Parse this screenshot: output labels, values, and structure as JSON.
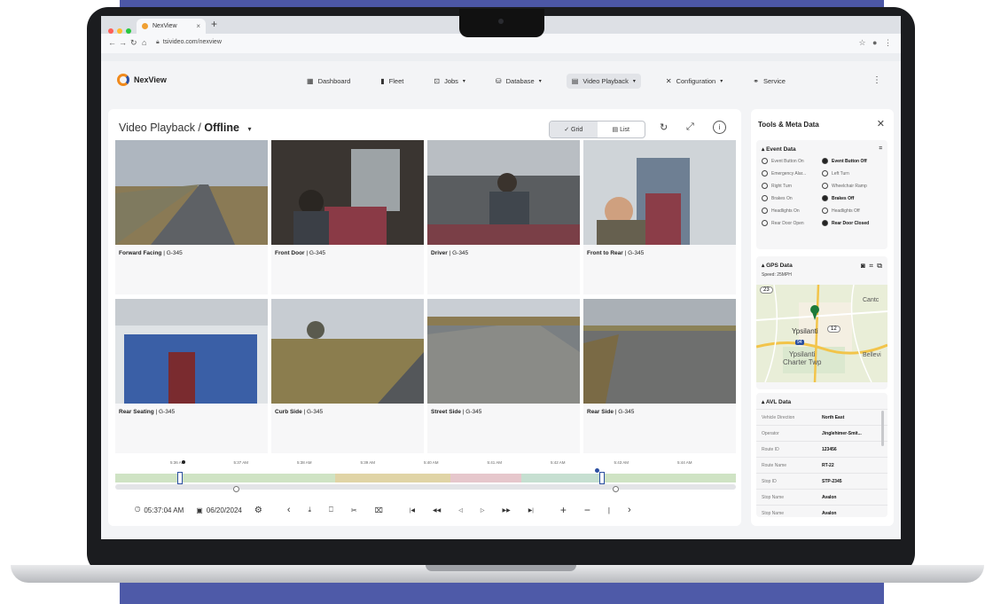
{
  "browser": {
    "tab_title": "NexView",
    "tab_close": "×",
    "new_tab": "+",
    "url": "tsivideo.com/nexview"
  },
  "app": {
    "brand": "NexView",
    "nav": [
      {
        "label": "Dashboard",
        "icon": "dashboard-icon",
        "dropdown": false,
        "active": false
      },
      {
        "label": "Fleet",
        "icon": "fleet-icon",
        "dropdown": false,
        "active": false
      },
      {
        "label": "Jobs",
        "icon": "jobs-icon",
        "dropdown": true,
        "active": false
      },
      {
        "label": "Database",
        "icon": "database-icon",
        "dropdown": true,
        "active": false
      },
      {
        "label": "Video Playback",
        "icon": "video-icon",
        "dropdown": true,
        "active": true
      },
      {
        "label": "Configuration",
        "icon": "tools-icon",
        "dropdown": true,
        "active": false
      },
      {
        "label": "Service",
        "icon": "service-icon",
        "dropdown": false,
        "active": false
      }
    ]
  },
  "main": {
    "title_prefix": "Video Playback / ",
    "title_mode": "Offline",
    "view_grid": "✓  Grid",
    "view_list": "▤  List",
    "cameras": [
      {
        "name": "Forward Facing",
        "id": " | G-345"
      },
      {
        "name": "Front Door",
        "id": " | G-345"
      },
      {
        "name": "Driver",
        "id": " | G-345"
      },
      {
        "name": "Front to Rear",
        "id": " | G-345"
      },
      {
        "name": "Rear Seating",
        "id": " | G-345"
      },
      {
        "name": "Curb Side",
        "id": " | G-345"
      },
      {
        "name": "Street Side",
        "id": " | G-345"
      },
      {
        "name": "Rear Side",
        "id": " | G-345"
      }
    ]
  },
  "timeline": {
    "ticks": [
      "5:36 AM",
      "5:37 AM",
      "5:38 AM",
      "5:39 AM",
      "5:40 AM",
      "5:41 AM",
      "5:42 AM",
      "5:43 AM",
      "5:44 AM"
    ],
    "segment_colors": [
      "#cfe3c4",
      "#e0d4a6",
      "#e6c7cc",
      "#c6dfd1",
      "#cfe3c4"
    ],
    "time": "05:37:04 AM",
    "date": "06/20/2024"
  },
  "side": {
    "title": "Tools & Meta Data",
    "event_section": "Event Data",
    "events": [
      {
        "label": "Event Button On",
        "selected": false
      },
      {
        "label": "Event Button Off",
        "selected": true
      },
      {
        "label": "Emergency Alar...",
        "selected": false
      },
      {
        "label": "Left Turn",
        "selected": false
      },
      {
        "label": "Right Turn",
        "selected": false
      },
      {
        "label": "Wheelchair Ramp",
        "selected": false
      },
      {
        "label": "Brakes On",
        "selected": false
      },
      {
        "label": "Brakes Off",
        "selected": true
      },
      {
        "label": "Headlights On",
        "selected": false
      },
      {
        "label": "Headlights Off",
        "selected": false
      },
      {
        "label": "Rear Door Open",
        "selected": false
      },
      {
        "label": "Rear Door Closed",
        "selected": true
      }
    ],
    "gps_section": "GPS Data",
    "speed": "Speed: 25MPH",
    "map_labels": {
      "ypsilanti": "Ypsilanti",
      "charter": "Ypsilanti\nCharter Twp",
      "canton": "Cantc",
      "belleville": "Bellevi",
      "route12": "12",
      "route23": "23",
      "route94": "94"
    },
    "avl_section": "AVL Data",
    "avl": [
      {
        "k": "Vehicle Direction",
        "v": "North East"
      },
      {
        "k": "Operator",
        "v": "Jinglehimer-Smit..."
      },
      {
        "k": "Route ID",
        "v": "123456"
      },
      {
        "k": "Route Name",
        "v": "RT-22"
      },
      {
        "k": "Stop ID",
        "v": "STP-2345"
      },
      {
        "k": "Stop Name",
        "v": "Avalon"
      },
      {
        "k": "Stop Name",
        "v": "Avalon"
      }
    ]
  }
}
